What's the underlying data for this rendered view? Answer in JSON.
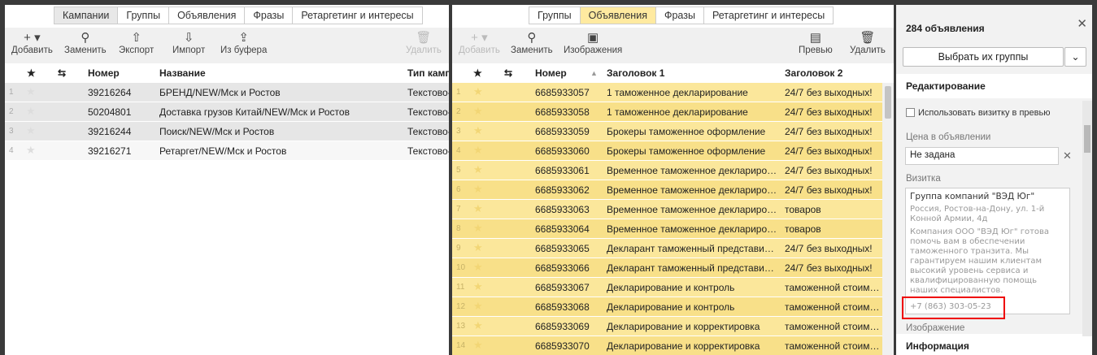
{
  "left": {
    "tabs": [
      "Кампании",
      "Группы",
      "Объявления",
      "Фразы",
      "Ретаргетинг и интересы"
    ],
    "toolbar": {
      "add": "Добавить",
      "replace": "Заменить",
      "export": "Экспорт",
      "import": "Импорт",
      "clipboard": "Из буфера",
      "delete": "Удалить"
    },
    "columns": {
      "star": "★",
      "num": "Номер",
      "name": "Название",
      "type": "Тип камп"
    },
    "rows": [
      {
        "idx": "1",
        "num": "39216264",
        "name": "БРЕНД/NEW/Мск и Ростов",
        "type": "Текстово-"
      },
      {
        "idx": "2",
        "num": "50204801",
        "name": "Доставка грузов Китай/NEW/Мск и Ростов",
        "type": "Текстово-"
      },
      {
        "idx": "3",
        "num": "39216244",
        "name": "Поиск/NEW/Мск и Ростов",
        "type": "Текстово-"
      },
      {
        "idx": "4",
        "num": "39216271",
        "name": "Ретаргет/NEW/Мск и Ростов",
        "type": "Текстово-"
      }
    ]
  },
  "mid": {
    "tabs": [
      "Группы",
      "Объявления",
      "Фразы",
      "Ретаргетинг и интересы"
    ],
    "toolbar": {
      "add": "Добавить",
      "replace": "Заменить",
      "images": "Изображения",
      "preview": "Превью",
      "delete": "Удалить"
    },
    "columns": {
      "star": "★",
      "num": "Номер",
      "title1": "Заголовок 1",
      "title2": "Заголовок 2"
    },
    "rows": [
      {
        "idx": "1",
        "num": "6685933057",
        "t1": "1 таможенное декларирование",
        "t2": "24/7 без выходных!"
      },
      {
        "idx": "2",
        "num": "6685933058",
        "t1": "1 таможенное декларирование",
        "t2": "24/7 без выходных!"
      },
      {
        "idx": "3",
        "num": "6685933059",
        "t1": "Брокеры таможенное оформление",
        "t2": "24/7 без выходных!"
      },
      {
        "idx": "4",
        "num": "6685933060",
        "t1": "Брокеры таможенное оформление",
        "t2": "24/7 без выходных!"
      },
      {
        "idx": "5",
        "num": "6685933061",
        "t1": "Временное таможенное декларирование",
        "t2": "24/7 без выходных!"
      },
      {
        "idx": "6",
        "num": "6685933062",
        "t1": "Временное таможенное декларирование",
        "t2": "24/7 без выходных!"
      },
      {
        "idx": "7",
        "num": "6685933063",
        "t1": "Временное таможенное декларирование",
        "t2": "товаров"
      },
      {
        "idx": "8",
        "num": "6685933064",
        "t1": "Временное таможенное декларирование",
        "t2": "товаров"
      },
      {
        "idx": "9",
        "num": "6685933065",
        "t1": "Декларант таможенный представитель",
        "t2": "24/7 без выходных!"
      },
      {
        "idx": "10",
        "num": "6685933066",
        "t1": "Декларант таможенный представитель",
        "t2": "24/7 без выходных!"
      },
      {
        "idx": "11",
        "num": "6685933067",
        "t1": "Декларирование и контроль",
        "t2": "таможенной стоимости"
      },
      {
        "idx": "12",
        "num": "6685933068",
        "t1": "Декларирование и контроль",
        "t2": "таможенной стоимости"
      },
      {
        "idx": "13",
        "num": "6685933069",
        "t1": "Декларирование и корректировка",
        "t2": "таможенной стоимости"
      },
      {
        "idx": "14",
        "num": "6685933070",
        "t1": "Декларирование и корректировка",
        "t2": "таможенной стоимости"
      }
    ]
  },
  "right": {
    "count_title": "284 объявления",
    "select_groups": "Выбрать их группы",
    "editing": "Редактирование",
    "use_vcard": "Использовать визитку в превью",
    "price_label": "Цена в объявлении",
    "price_value": "Не задана",
    "vcard_label": "Визитка",
    "vcard": {
      "name": "Группа компаний \"ВЭД Юг\"",
      "address": "Россия, Ростов-на-Дону, ул. 1-й Конной Армии, 4д",
      "description": "Компания ООО \"ВЭД Юг\" готова помочь вам в обеспечении таможенного транзита. Мы гарантируем нашим клиентам высокий уровень сервиса и квалифицированную помощь наших специалистов.",
      "phone": "+7 (863) 303-05-23"
    },
    "image_label": "Изображение",
    "info": "Информация"
  },
  "colors": {
    "selected_row": "#fbe79b",
    "active_tab": "#ffeaa0",
    "highlight": "#e00000"
  }
}
